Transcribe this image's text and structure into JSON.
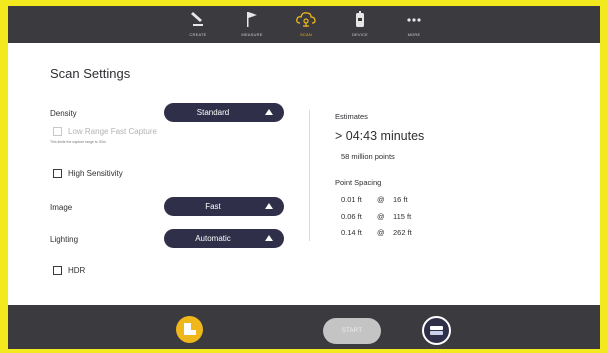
{
  "nav": {
    "tabs": [
      {
        "label": "CREATE",
        "icon": "pencil-icon"
      },
      {
        "label": "MEASURE",
        "icon": "flag-icon"
      },
      {
        "label": "SCAN",
        "icon": "cloud-scan-icon",
        "active": true
      },
      {
        "label": "DEVICE",
        "icon": "device-icon"
      },
      {
        "label": "MORE",
        "icon": "more-dots-icon"
      }
    ]
  },
  "settings": {
    "title": "Scan Settings",
    "density": {
      "label": "Density",
      "value": "Standard"
    },
    "low_range": {
      "label": "Low Range Fast Capture",
      "note": "This limits the capture range to 30m",
      "checked": false,
      "disabled": true
    },
    "high_sensitivity": {
      "label": "High Sensitivity",
      "checked": false
    },
    "image": {
      "label": "Image",
      "value": "Fast"
    },
    "lighting": {
      "label": "Lighting",
      "value": "Automatic"
    },
    "hdr": {
      "label": "HDR",
      "checked": false
    }
  },
  "estimates": {
    "heading": "Estimates",
    "time": ">  04:43 minutes",
    "points": "58  million points",
    "spacing_heading": "Point Spacing",
    "spacing": [
      {
        "spacing": "0.01 ft",
        "at": "@",
        "distance": "16 ft"
      },
      {
        "spacing": "0.06 ft",
        "at": "@",
        "distance": "115 ft"
      },
      {
        "spacing": "0.14 ft",
        "at": "@",
        "distance": "262 ft"
      }
    ]
  },
  "bottom": {
    "start_label": "START"
  },
  "colors": {
    "accent": "#f0b71c",
    "bar": "#3a3a3f",
    "pill": "#2f2f4a",
    "border": "#f2ea1e"
  }
}
